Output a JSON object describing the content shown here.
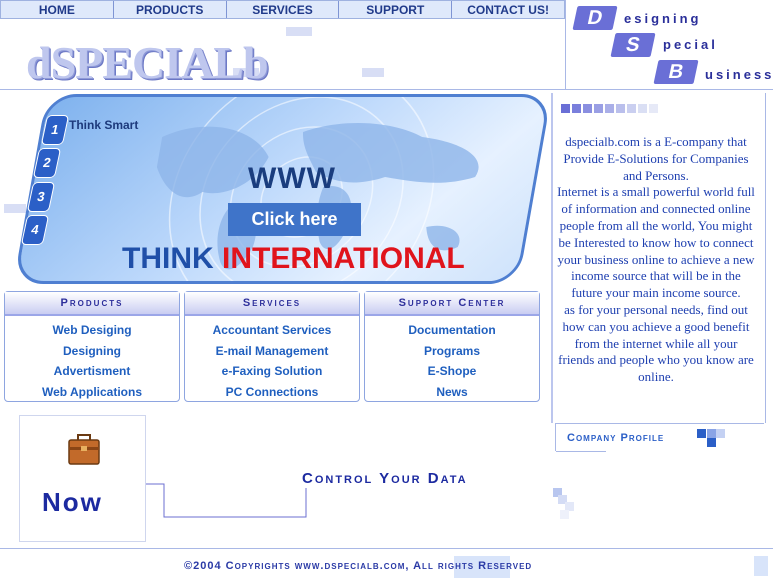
{
  "nav": [
    "HOME",
    "PRODUCTS",
    "SERVICES",
    "SUPPORT",
    "CONTACT US!"
  ],
  "logo": "dSPECIALb",
  "brand": {
    "letters": [
      "D",
      "S",
      "B"
    ],
    "words": [
      "esigning",
      "pecial",
      "usiness"
    ]
  },
  "banner": {
    "numbers": [
      "1",
      "2",
      "3",
      "4"
    ],
    "think_smart": "Think Smart",
    "www": "WWW",
    "click": "Click here",
    "think": "THINK",
    "international": "INTERNATIONAL"
  },
  "boxes": [
    {
      "title": "Products",
      "links": [
        "Web Desiging",
        "Designing",
        "Advertisment",
        "Web Applications"
      ]
    },
    {
      "title": "Services",
      "links": [
        "Accountant Services",
        "E-mail Management",
        "e-Faxing Solution",
        "PC Connections"
      ]
    },
    {
      "title": "Support Center",
      "links": [
        "Documentation",
        "Programs",
        "E-Shope",
        "News"
      ]
    }
  ],
  "panel": {
    "text1": "dspecialb.com is a E-company that Provide E-Solutions for Companies and Persons.",
    "text2": "Internet is a small powerful world full of information and connected online people from all the world, You might be Interested to know how to connect your business online to achieve a new income source that will be in the future your main income source.",
    "text3": "as for your personal needs, find out how can you achieve a good benefit from the internet while all your friends and people who you know are online.",
    "company_profile": "Company Profile"
  },
  "now": "Now",
  "control": "Control Your Data",
  "footer": "©2004 Copyrights www.dspecialb.com, All rights Reserved",
  "colors": {
    "accent": "#2b5fc7",
    "brand": "#2a2f9a",
    "red": "#e0141c"
  }
}
